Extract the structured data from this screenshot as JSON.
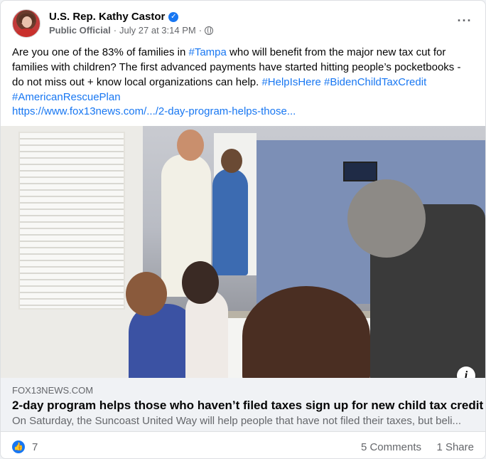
{
  "post": {
    "author": "U.S. Rep. Kathy Castor",
    "role": "Public Official",
    "separator": "·",
    "timestamp": "July 27 at 3:14 PM",
    "audience_icon": "globe-icon",
    "verified_icon": "verified-badge-icon",
    "more_icon": "more-options-icon",
    "text_parts": {
      "p1": "Are you one of the 83% of families in ",
      "tag_tampa": "#Tampa",
      "p2": " who will benefit from the major new tax cut for families with children? The first advanced payments have started hitting people’s pocketbooks - do not miss out + know local organizations can help. ",
      "tag_helpishere": "#HelpIsHere",
      "tag_bidenchildtaxcredit": "#BidenChildTaxCredit",
      "tag_americanrescueplan": "#AmericanRescuePlan"
    },
    "link_url": "https://www.fox13news.com/.../2-day-program-helps-those..."
  },
  "link_preview": {
    "domain": "FOX13NEWS.COM",
    "headline": "2-day program helps those who haven’t filed taxes sign up for new child tax credit",
    "description": "On Saturday, the Suncoast United Way will help people that have not filed their taxes, but beli...",
    "info_icon": "i"
  },
  "engagement": {
    "reaction_icon": "like-icon",
    "reaction_count": "7",
    "comments": "5 Comments",
    "shares": "1 Share"
  },
  "colors": {
    "link": "#1877f2",
    "secondary_text": "#65676b",
    "preview_bg": "#f0f2f5"
  }
}
